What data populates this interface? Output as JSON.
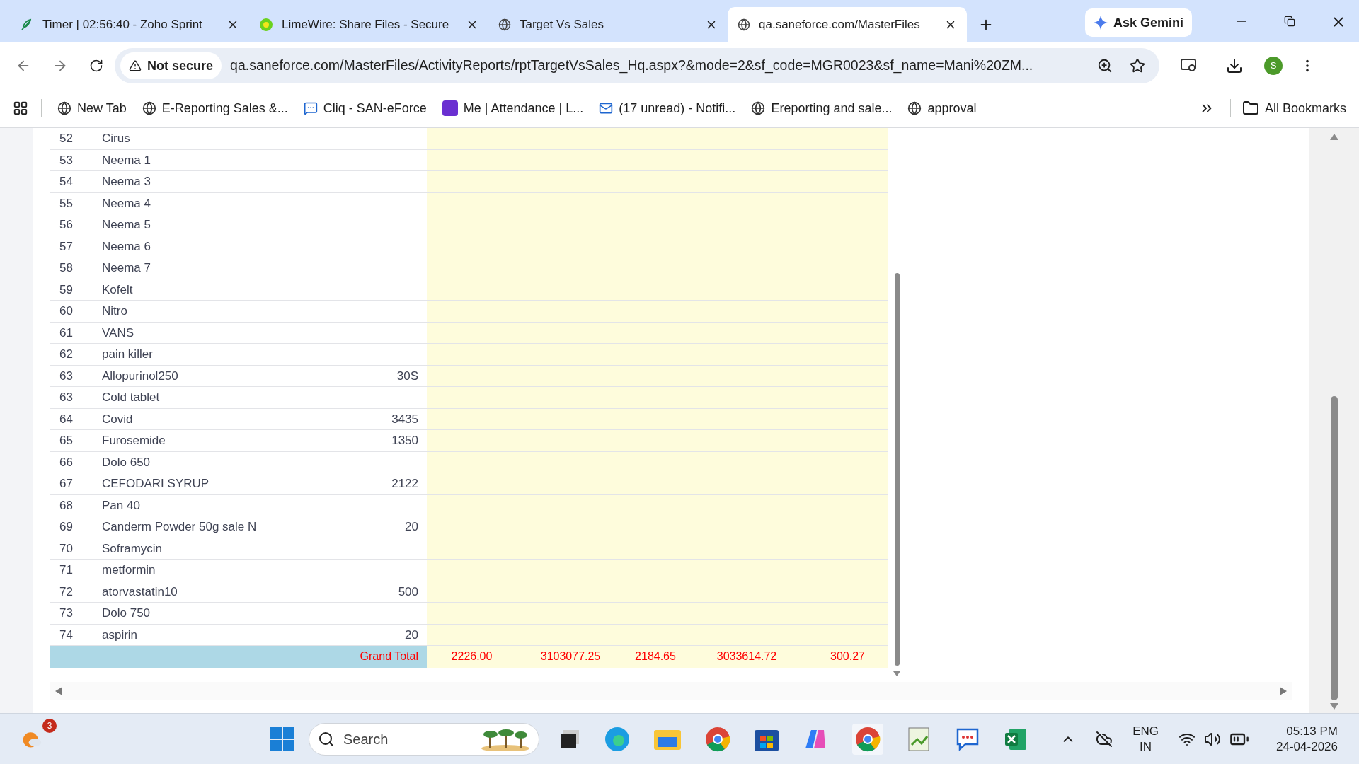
{
  "browser": {
    "tabs": [
      {
        "title": "Timer | 02:56:40 - Zoho Sprint",
        "selected": false
      },
      {
        "title": "LimeWire: Share Files - Secure",
        "selected": false
      },
      {
        "title": "Target Vs Sales",
        "selected": false
      },
      {
        "title": "qa.saneforce.com/MasterFiles",
        "selected": true
      }
    ],
    "gemini_button": "Ask Gemini",
    "security_label": "Not secure",
    "address": "qa.saneforce.com/MasterFiles/ActivityReports/rptTargetVsSales_Hq.aspx?&mode=2&sf_code=MGR0023&sf_name=Mani%20ZM...",
    "profile_initial": "S",
    "bookmarks": [
      "New Tab",
      "E-Reporting Sales &...",
      "Cliq - SAN-eForce",
      "Me | Attendance | L...",
      "(17 unread) - Notifi...",
      "Ereporting and sale...",
      "approval"
    ],
    "all_bookmarks": "All Bookmarks"
  },
  "table": {
    "rows": [
      {
        "index": "52",
        "name": "Cirus"
      },
      {
        "index": "53",
        "name": "Neema 1"
      },
      {
        "index": "54",
        "name": "Neema 3"
      },
      {
        "index": "55",
        "name": "Neema 4"
      },
      {
        "index": "56",
        "name": "Neema 5"
      },
      {
        "index": "57",
        "name": "Neema 6"
      },
      {
        "index": "58",
        "name": "Neema 7"
      },
      {
        "index": "59",
        "name": "Kofelt"
      },
      {
        "index": "60",
        "name": "Nitro"
      },
      {
        "index": "61",
        "name": "VANS"
      },
      {
        "index": "62",
        "name": "pain killer"
      },
      {
        "index": "63",
        "name": "Allopurinol250",
        "value": "30S"
      },
      {
        "index": "63",
        "name": "Cold tablet"
      },
      {
        "index": "64",
        "name": "Covid",
        "value": "3435"
      },
      {
        "index": "65",
        "name": "Furosemide",
        "value": "1350"
      },
      {
        "index": "66",
        "name": "Dolo 650"
      },
      {
        "index": "67",
        "name": "CEFODARI SYRUP",
        "value": "2122"
      },
      {
        "index": "68",
        "name": "Pan 40"
      },
      {
        "index": "69",
        "name": "Canderm Powder 50g sale N",
        "value": "20"
      },
      {
        "index": "70",
        "name": "Soframycin"
      },
      {
        "index": "71",
        "name": "metformin"
      },
      {
        "index": "72",
        "name": "atorvastatin10",
        "value": "500"
      },
      {
        "index": "73",
        "name": "Dolo 750"
      },
      {
        "index": "74",
        "name": "aspirin",
        "value": "20"
      }
    ],
    "grand_total": {
      "label": "Grand Total",
      "values": [
        "2226.00",
        "3103077.25",
        "2184.65",
        "3033614.72",
        "300.27"
      ]
    }
  },
  "taskbar": {
    "weather_badge": "3",
    "search_placeholder": "Search",
    "language": "ENG",
    "region": "IN",
    "time": "05:13 PM",
    "date": "24-04-2026"
  }
}
